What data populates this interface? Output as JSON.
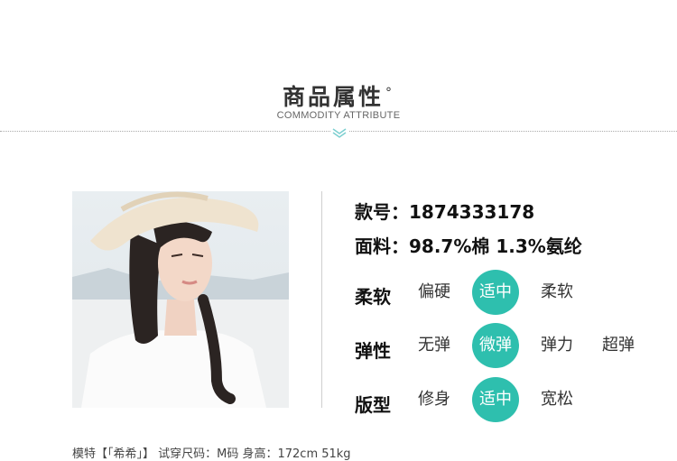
{
  "header": {
    "title": "商品属性",
    "degree": "°",
    "subtitle": "COMMODITY ATTRIBUTE"
  },
  "info": {
    "style_no_label": "款号：",
    "style_no": "1874333178",
    "fabric_label": "面料：",
    "fabric": "98.7%棉 1.3%氨纶"
  },
  "attributes": [
    {
      "label": "柔软",
      "options": [
        "偏硬",
        "适中",
        "柔软"
      ],
      "selected": "适中"
    },
    {
      "label": "弹性",
      "options": [
        "无弹",
        "微弹",
        "弹力",
        "超弹"
      ],
      "selected": "微弹"
    },
    {
      "label": "版型",
      "options": [
        "修身",
        "适中",
        "宽松"
      ],
      "selected": "适中"
    }
  ],
  "caption": "模特【「希希」】 试穿尺码：M码 身高：172cm 51kg",
  "colors": {
    "accent": "#2ebfae"
  }
}
